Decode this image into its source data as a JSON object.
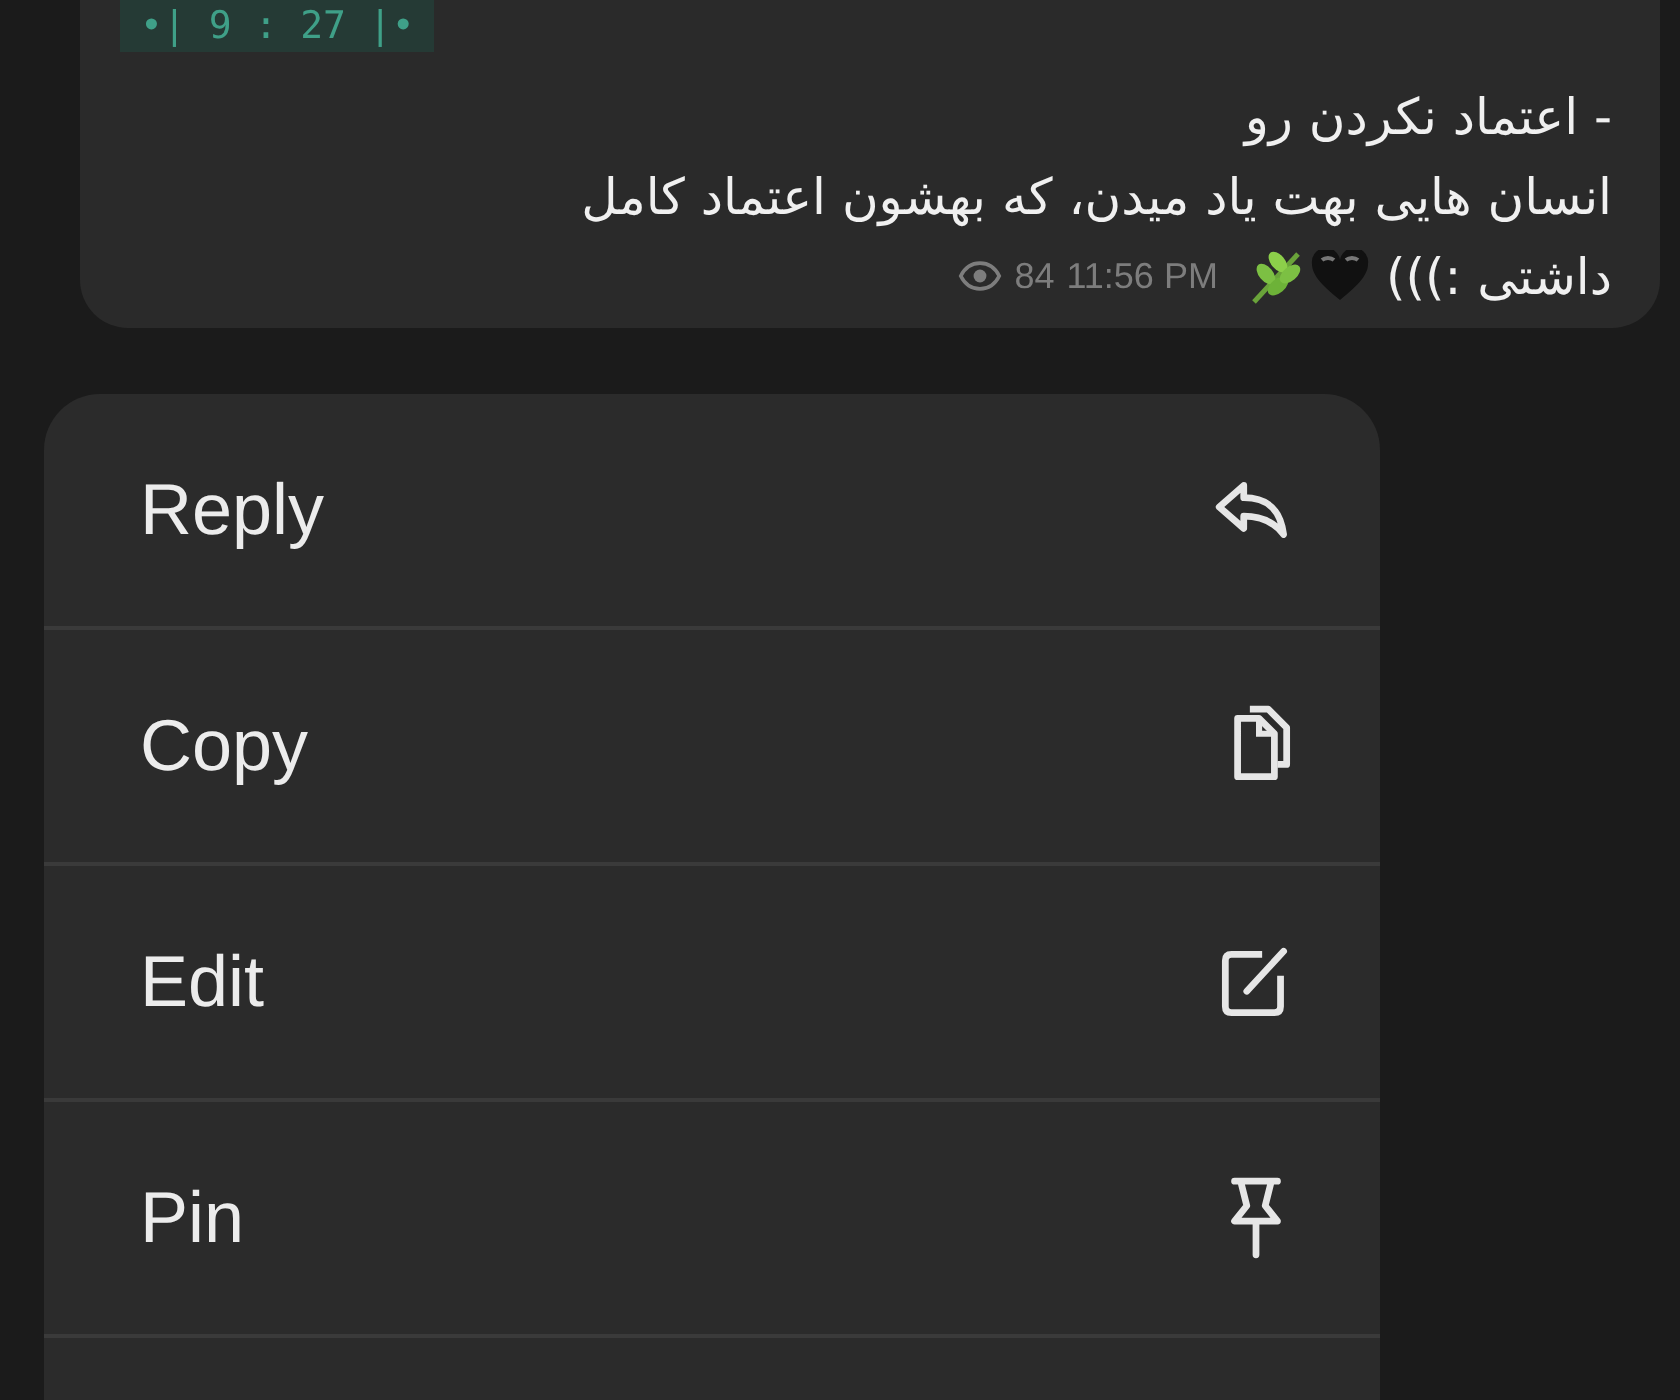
{
  "message": {
    "tag": "•| 9 : 27 |•",
    "lines": [
      "- اعتماد نکردن رو",
      "انسان هایی بهت یاد میدن، که بهشون اعتماد کامل",
      "داشتی :)))"
    ],
    "views": "84",
    "time": "11:56 PM"
  },
  "menu": [
    {
      "label": "Reply",
      "kind": "reply"
    },
    {
      "label": "Copy",
      "kind": "copy"
    },
    {
      "label": "Edit",
      "kind": "edit"
    },
    {
      "label": "Pin",
      "kind": "pin"
    }
  ]
}
